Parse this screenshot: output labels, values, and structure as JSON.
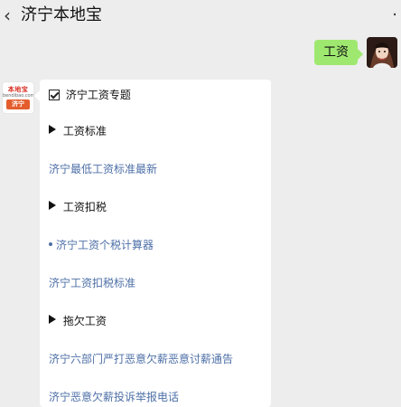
{
  "header": {
    "title": "济宁本地宝",
    "back_icon": "chevron-left-icon",
    "more_icon": "more-dots-icon"
  },
  "user_message": {
    "text": "工资",
    "avatar": "user-avatar"
  },
  "bot_avatar": {
    "logo_text": "本地宝",
    "logo_url": "bendibao.com",
    "badge": "济宁"
  },
  "bot_message": {
    "title": "济宁工资专题",
    "sections": [
      {
        "heading": "工资标准",
        "links": [
          "济宁最低工资标准最新"
        ]
      },
      {
        "heading": "工资扣税",
        "links": [
          "济宁工资个税计算器",
          "济宁工资扣税标准"
        ]
      },
      {
        "heading": "拖欠工资",
        "links": [
          "济宁六部门严打恶意欠薪恶意讨薪通告",
          "济宁恶意欠薪投诉举报电话"
        ]
      }
    ]
  },
  "colors": {
    "background": "#ededed",
    "user_bubble": "#9fe870",
    "link": "#4d6fa7",
    "badge": "#e45d2d"
  }
}
